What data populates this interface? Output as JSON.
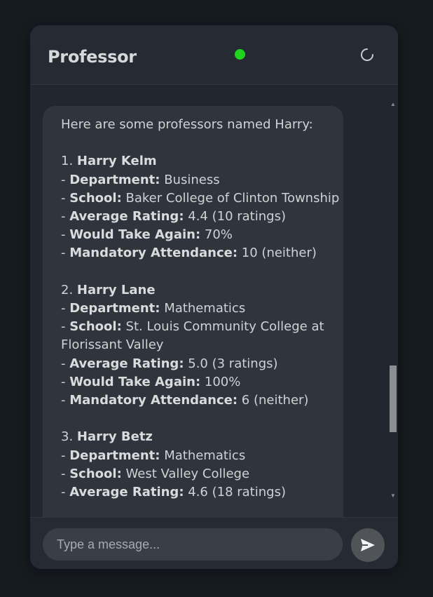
{
  "header": {
    "title": "Professor",
    "status_color": "#1fd31f"
  },
  "message": {
    "intro": "Here are some professors named Harry:",
    "professors": [
      {
        "number": "1.",
        "name": "Harry Kelm",
        "department_label": "Department:",
        "department": "Business",
        "school_label": "School:",
        "school": "Baker College of Clinton Township",
        "rating_label": "Average Rating:",
        "rating": "4.4 (10 ratings)",
        "again_label": "Would Take Again:",
        "again": "70%",
        "attendance_label": "Mandatory Attendance:",
        "attendance": "10 (neither)"
      },
      {
        "number": "2.",
        "name": "Harry Lane",
        "department_label": "Department:",
        "department": "Mathematics",
        "school_label": "School:",
        "school": "St. Louis Community College at Florissant Valley",
        "rating_label": "Average Rating:",
        "rating": "5.0 (3 ratings)",
        "again_label": "Would Take Again:",
        "again": "100%",
        "attendance_label": "Mandatory Attendance:",
        "attendance": "6 (neither)"
      },
      {
        "number": "3.",
        "name": "Harry Betz",
        "department_label": "Department:",
        "department": "Mathematics",
        "school_label": "School:",
        "school": "West Valley College",
        "rating_label": "Average Rating:",
        "rating": "4.6 (18 ratings)"
      }
    ]
  },
  "input": {
    "placeholder": "Type a message..."
  },
  "icons": {
    "spinner": "spinner-icon",
    "send": "send-icon",
    "scroll_up": "scroll-up-arrow",
    "scroll_down": "scroll-down-arrow"
  }
}
